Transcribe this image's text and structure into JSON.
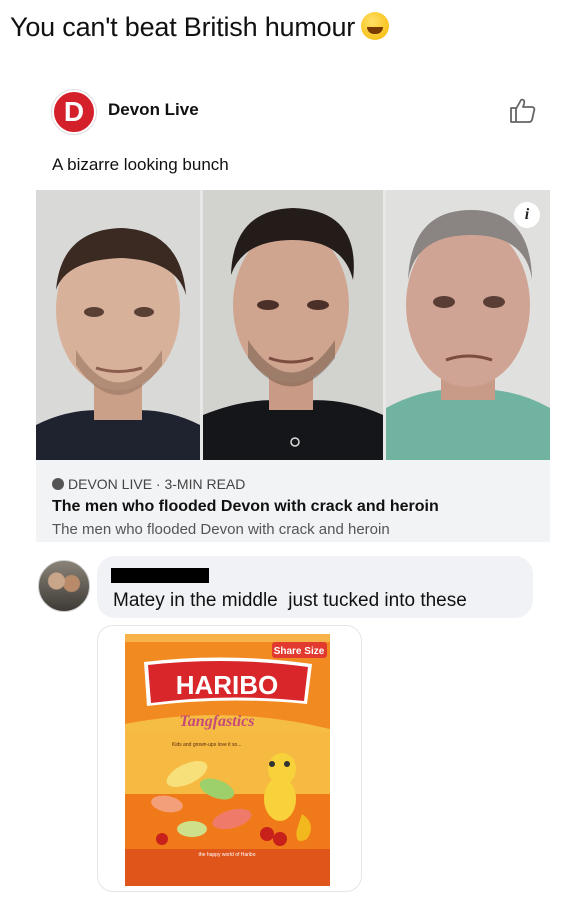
{
  "caption": {
    "text": "You can't beat British humour",
    "emoji": "rolling-on-floor-laughing-emoji"
  },
  "post": {
    "logo_letter": "D",
    "page_name": "Devon Live",
    "text": "A bizarre looking bunch",
    "info_label": "i",
    "link": {
      "source": "DEVON LIVE · 3-MIN READ",
      "title": "The men who flooded Devon with crack and heroin",
      "description": "The men who flooded Devon with crack and heroin"
    }
  },
  "comment": {
    "text": "Matey in the middle  just tucked into these"
  },
  "product": {
    "brand": "HARIBO",
    "name": "Tangfastics",
    "badge": "Share Size",
    "tagline": "Kids and grown-ups love it so...",
    "footer": "the happy world of Haribo"
  },
  "colors": {
    "haribo_red": "#d8262b",
    "bag_orange": "#f07a1a",
    "logo_red": "#d4202a"
  }
}
